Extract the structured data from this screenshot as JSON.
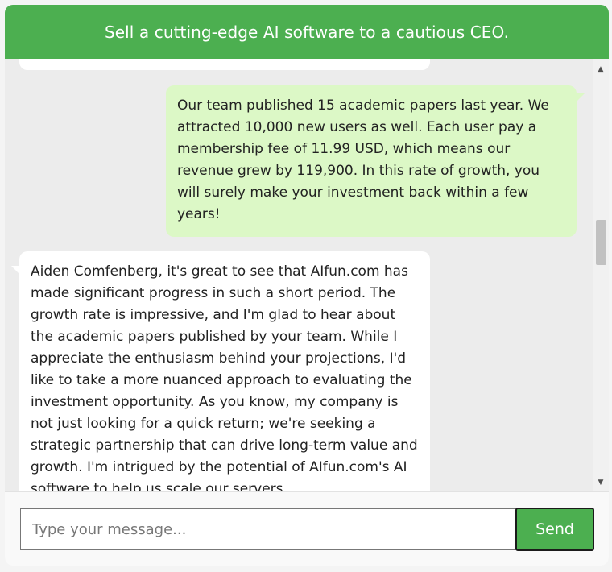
{
  "header": {
    "title": "Sell a cutting-edge AI software to a cautious CEO."
  },
  "messages": [
    {
      "role": "user",
      "text": "Our team published 15 academic papers last year. We attracted 10,000 new users as well. Each user pay a membership fee of 11.99 USD, which means our revenue grew by 119,900. In this rate of growth, you will surely make your investment back within a few years!"
    },
    {
      "role": "ai",
      "text": "Aiden Comfenberg, it's great to see that AIfun.com has made significant progress in such a short period. The growth rate is impressive, and I'm glad to hear about the academic papers published by your team. While I appreciate the enthusiasm behind your projections, I'd like to take a more nuanced approach to evaluating the investment opportunity. As you know, my company is not just looking for a quick return; we're seeking a strategic partnership that can drive long-term value and growth. I'm intrigued by the potential of AIfun.com's AI software to help us scale our servers"
    }
  ],
  "input": {
    "placeholder": "Type your message...",
    "value": ""
  },
  "send_button": {
    "label": "Send"
  },
  "icons": {
    "scroll_up": "scroll-up-arrow-icon",
    "scroll_down": "scroll-down-arrow-icon"
  },
  "colors": {
    "header": "#4caf50",
    "user_bubble": "#dcf8c6",
    "ai_bubble": "#ffffff",
    "send_button": "#4caf50"
  }
}
